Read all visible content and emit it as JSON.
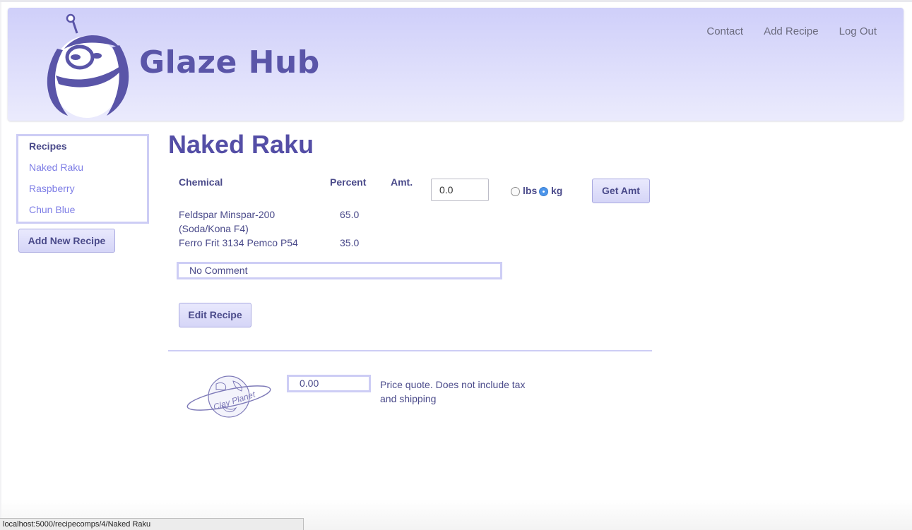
{
  "brand": {
    "name": "Glaze Hub"
  },
  "nav": {
    "items": [
      "Contact",
      "Add Recipe",
      "Log Out"
    ]
  },
  "sidebar": {
    "title": "Recipes",
    "items": [
      "Naked Raku",
      "Raspberry",
      "Chun Blue"
    ],
    "add_button": "Add New Recipe"
  },
  "recipe": {
    "title": "Naked Raku",
    "headers": {
      "chemical": "Chemical",
      "percent": "Percent",
      "amt": "Amt."
    },
    "amount_value": "0.0",
    "units": {
      "lbs": "lbs",
      "kg": "kg",
      "selected": "kg"
    },
    "get_amt_button": "Get Amt",
    "rows": [
      {
        "chemical_line1": "Feldspar Minspar-200",
        "chemical_line2": "(Soda/Kona F4)",
        "percent": "65.0"
      },
      {
        "chemical_line1": "Ferro Frit 3134 Pemco P54",
        "percent": "35.0"
      }
    ],
    "comment": "No Comment",
    "edit_button": "Edit Recipe"
  },
  "price": {
    "logo_text": "Clay Planet",
    "value": "0.00",
    "note": "Price quote. Does not include tax and shipping"
  },
  "status_bar": {
    "url": "localhost:5000/recipecomps/4/Naked Raku"
  },
  "colors": {
    "accent": "#544ea6",
    "link": "#7e7ee6",
    "border": "#cdcdf5",
    "header_top": "#cfcff9"
  }
}
